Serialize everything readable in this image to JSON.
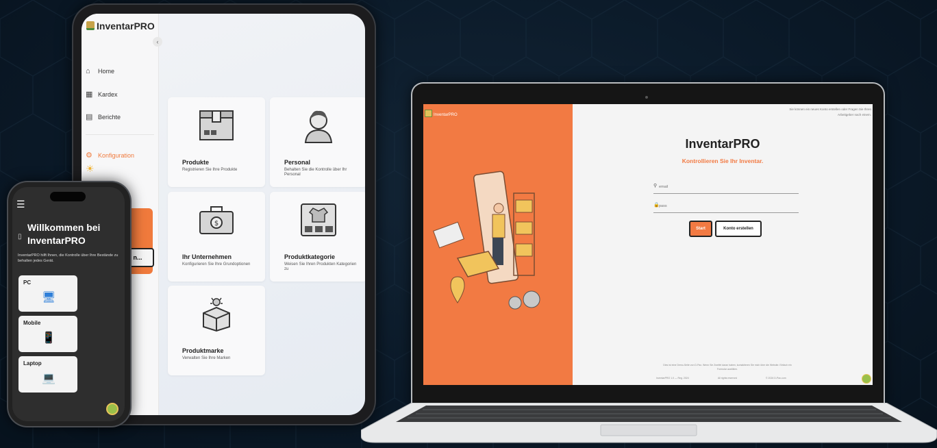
{
  "tablet": {
    "brand": "InventarPRO",
    "nav": [
      {
        "label": "Home",
        "icon": "home-icon"
      },
      {
        "label": "Kardex",
        "icon": "boxes-icon"
      },
      {
        "label": "Berichte",
        "icon": "clipboard-icon"
      }
    ],
    "config_label": "Konfiguration",
    "orange_tab_text": "n...",
    "cards": [
      {
        "title": "Produkte",
        "desc": "Registrieren Sie Ihre Produkte",
        "icon": "box-icon"
      },
      {
        "title": "Personal",
        "desc": "Behalten Sie die Kontrolle über Ihr Personal",
        "icon": "person-icon"
      },
      {
        "title": "Ihr Unternehmen",
        "desc": "Konfigurieren Sie Ihre Grundoptionen",
        "icon": "briefcase-icon"
      },
      {
        "title": "Produktkategorie",
        "desc": "Weisen Sie Ihren Produkten Kategorien zu",
        "icon": "category-icon"
      },
      {
        "title": "Produktmarke",
        "desc": "Verwalten Sie Ihre Marken",
        "icon": "brand-box-icon"
      }
    ]
  },
  "phone": {
    "title": "Willkommen bei InventarPRO",
    "desc": "InventarPRO hilft Ihnen, die Kontrolle über Ihre Bestände zu behalten jedes Gerät.",
    "devices": [
      {
        "label": "PC",
        "glyph": "🖥"
      },
      {
        "label": "Mobile",
        "glyph": "📱"
      },
      {
        "label": "Laptop",
        "glyph": "💻"
      }
    ]
  },
  "laptop": {
    "brand": "InventarPRO",
    "note": "Sie können ein neues Konto erstellen oder Fragen Sie Ihren Arbeitgeber nach einem.",
    "title": "InventarPRO",
    "subtitle": "Kontrollieren Sie Ihr Inventar.",
    "email_placeholder": "email",
    "pass_placeholder": "pass",
    "start_label": "Start",
    "konto_label": "Konto erstellen",
    "footer_note": "Dies ist eine Demo-Seite von D-Pax. Wenn Sie Zweifel daran haben, kontaktieren Sie mich über die Website. Einfach ein Formular ausfüllen.",
    "copy_left": "InventarPRO 1.0 — Reg. 2024",
    "copy_mid": "All rights reserved",
    "copy_right": "© 2024 D-Pax.com"
  },
  "colors": {
    "accent": "#f27a43",
    "background": "#0b1a29"
  }
}
